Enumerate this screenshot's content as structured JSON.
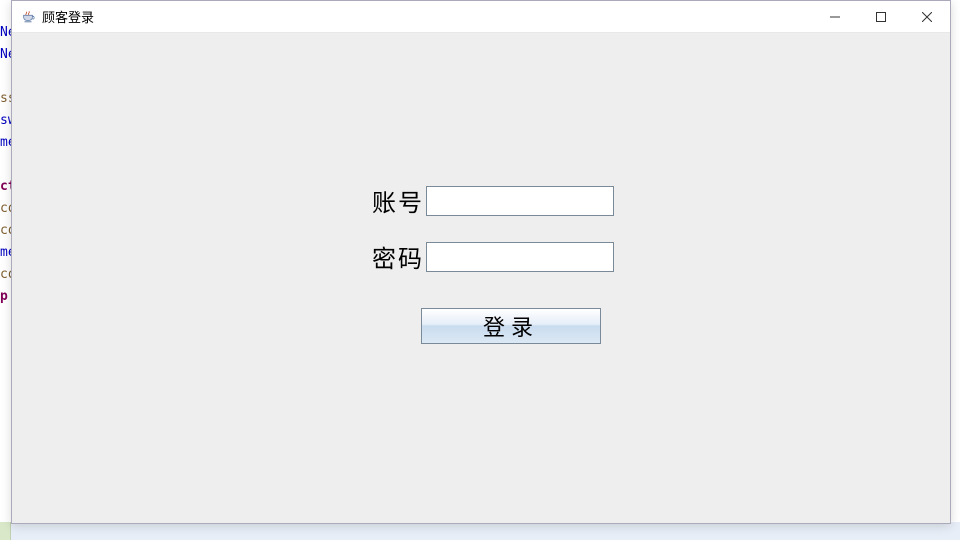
{
  "window": {
    "title": "顾客登录"
  },
  "form": {
    "account_label": "账号",
    "password_label": "密码",
    "account_value": "",
    "password_value": "",
    "login_button": "登录"
  },
  "background_code_fragments": {
    "line1": "Ne",
    "line2": "Ne",
    "line4": "ss",
    "line5": "sw",
    "line6": "me",
    "line8": "ct",
    "line9": "co",
    "line10": "co",
    "line11": "me",
    "line12": "co",
    "line13": "p"
  }
}
